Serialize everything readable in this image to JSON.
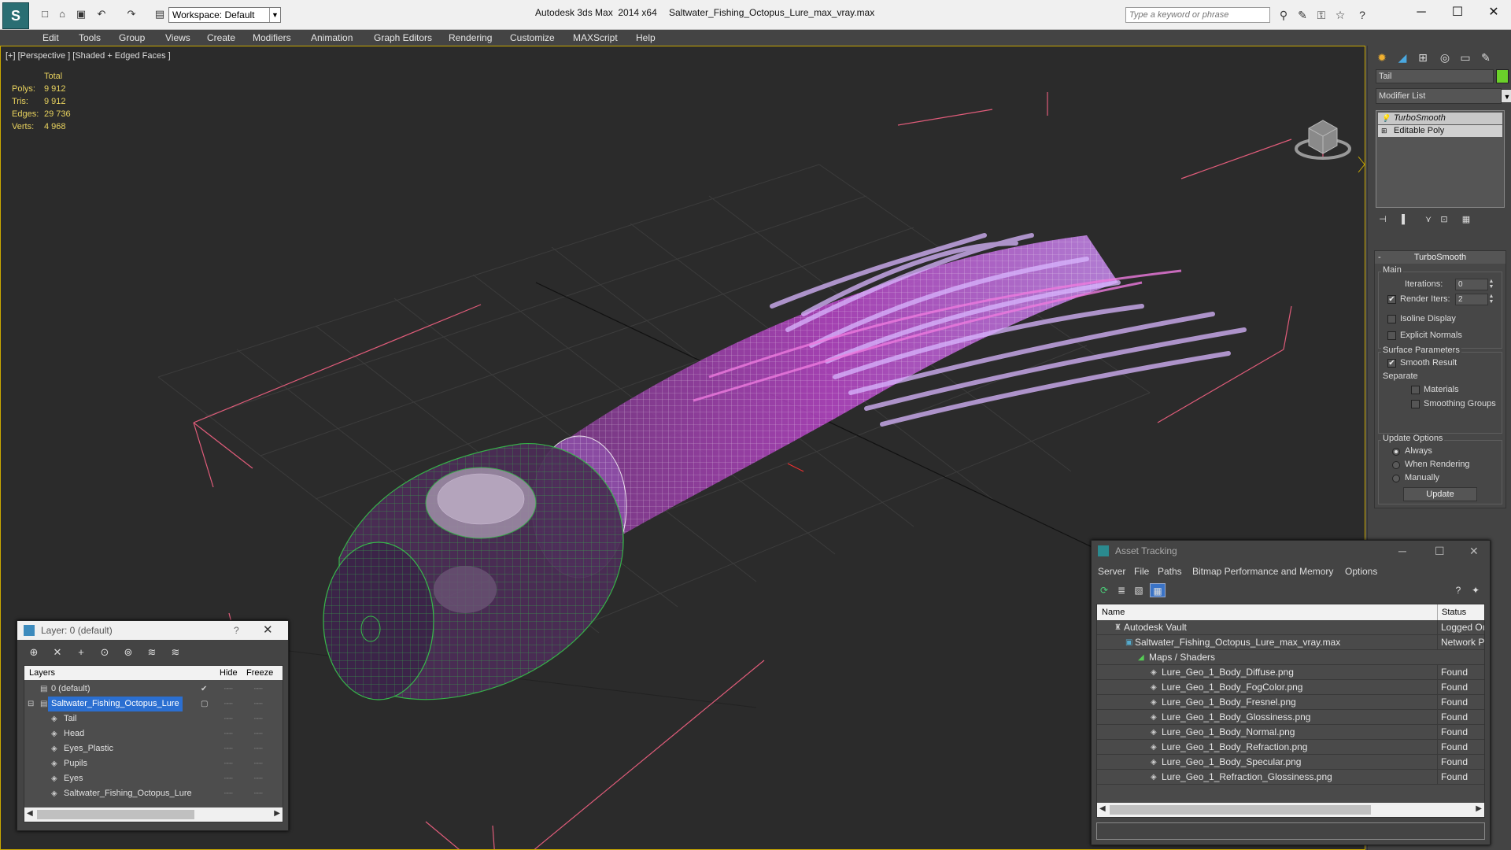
{
  "titlebar": {
    "workspace": "Workspace: Default",
    "app": "Autodesk 3ds Max  2014 x64",
    "file": "Saltwater_Fishing_Octopus_Lure_max_vray.max",
    "search_placeholder": "Type a keyword or phrase"
  },
  "menu": [
    "Edit",
    "Tools",
    "Group",
    "Views",
    "Create",
    "Modifiers",
    "Animation",
    "Graph Editors",
    "Rendering",
    "Customize",
    "MAXScript",
    "Help"
  ],
  "viewport": {
    "label": "[+] [Perspective ] [Shaded + Edged Faces ]",
    "stats": {
      "header": "Total",
      "polys_label": "Polys:",
      "polys": "9 912",
      "tris_label": "Tris:",
      "tris": "9 912",
      "edges_label": "Edges:",
      "edges": "29 736",
      "verts_label": "Verts:",
      "verts": "4 968"
    }
  },
  "command_panel": {
    "object_name": "Tail",
    "object_color": "#6bd12a",
    "modifier_list": "Modifier List",
    "stack": [
      "TurboSmooth",
      "Editable Poly"
    ],
    "rollout_title": "TurboSmooth",
    "main_label": "Main",
    "iterations_label": "Iterations:",
    "iterations": "0",
    "render_iters_label": "Render Iters:",
    "render_iters": "2",
    "isoline": "Isoline Display",
    "explicit_normals": "Explicit Normals",
    "surface_params": "Surface Parameters",
    "smooth_result": "Smooth Result",
    "separate": "Separate",
    "materials": "Materials",
    "smoothing_groups": "Smoothing Groups",
    "update_options": "Update Options",
    "always": "Always",
    "when_rendering": "When Rendering",
    "manually": "Manually",
    "update": "Update"
  },
  "layer_dialog": {
    "title": "Layer: 0 (default)",
    "help": "?",
    "headers": {
      "layers": "Layers",
      "hide": "Hide",
      "freeze": "Freeze"
    },
    "rows": [
      {
        "name": "0 (default)"
      },
      {
        "name": "Saltwater_Fishing_Octopus_Lure"
      },
      {
        "name": "Tail"
      },
      {
        "name": "Head"
      },
      {
        "name": "Eyes_Plastic"
      },
      {
        "name": "Pupils"
      },
      {
        "name": "Eyes"
      },
      {
        "name": "Saltwater_Fishing_Octopus_Lure"
      }
    ]
  },
  "asset_dialog": {
    "title": "Asset Tracking",
    "menu": [
      "Server",
      "File",
      "Paths",
      "Bitmap Performance and Memory",
      "Options"
    ],
    "headers": {
      "name": "Name",
      "status": "Status"
    },
    "rows": [
      {
        "name": "Autodesk Vault",
        "status": "Logged Ou"
      },
      {
        "name": "Saltwater_Fishing_Octopus_Lure_max_vray.max",
        "status": "Network Pa"
      },
      {
        "name": "Maps / Shaders",
        "status": ""
      },
      {
        "name": "Lure_Geo_1_Body_Diffuse.png",
        "status": "Found"
      },
      {
        "name": "Lure_Geo_1_Body_FogColor.png",
        "status": "Found"
      },
      {
        "name": "Lure_Geo_1_Body_Fresnel.png",
        "status": "Found"
      },
      {
        "name": "Lure_Geo_1_Body_Glossiness.png",
        "status": "Found"
      },
      {
        "name": "Lure_Geo_1_Body_Normal.png",
        "status": "Found"
      },
      {
        "name": "Lure_Geo_1_Body_Refraction.png",
        "status": "Found"
      },
      {
        "name": "Lure_Geo_1_Body_Specular.png",
        "status": "Found"
      },
      {
        "name": "Lure_Geo_1_Refraction_Glossiness.png",
        "status": "Found"
      }
    ]
  }
}
